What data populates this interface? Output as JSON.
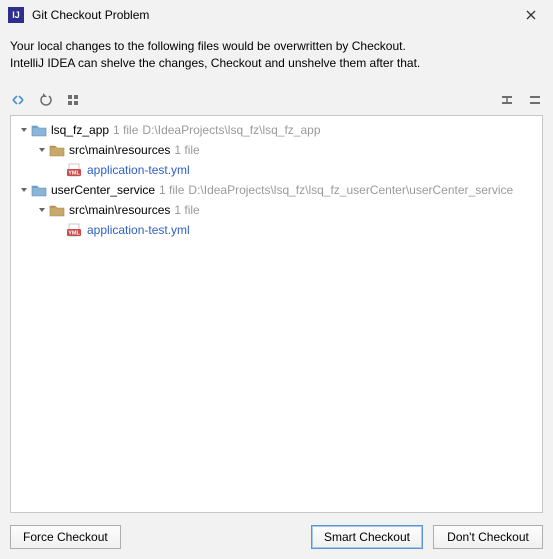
{
  "window": {
    "title": "Git Checkout Problem",
    "app_icon_text": "IJ"
  },
  "message": {
    "line1": "Your local changes to the following files would be overwritten by Checkout.",
    "line2": "IntelliJ IDEA can shelve the changes, Checkout and unshelve them after that."
  },
  "toolbar": {
    "diff": "diff-icon",
    "revert": "revert-icon",
    "group": "group-by-icon",
    "expand": "expand-all-icon",
    "collapse": "collapse-all-icon"
  },
  "tree": [
    {
      "level": 0,
      "expanded": true,
      "icon": "module",
      "label": "lsq_fz_app",
      "count": "1 file",
      "path": "D:\\IdeaProjects\\lsq_fz\\lsq_fz_app",
      "link": false
    },
    {
      "level": 1,
      "expanded": true,
      "icon": "folder",
      "label": "src\\main\\resources",
      "count": "1 file",
      "path": "",
      "link": false
    },
    {
      "level": 2,
      "expanded": null,
      "icon": "yml",
      "label": "application-test.yml",
      "count": "",
      "path": "",
      "link": true
    },
    {
      "level": 0,
      "expanded": true,
      "icon": "module",
      "label": "userCenter_service",
      "count": "1 file",
      "path": "D:\\IdeaProjects\\lsq_fz\\lsq_fz_userCenter\\userCenter_service",
      "link": false
    },
    {
      "level": 1,
      "expanded": true,
      "icon": "folder",
      "label": "src\\main\\resources",
      "count": "1 file",
      "path": "",
      "link": false
    },
    {
      "level": 2,
      "expanded": null,
      "icon": "yml",
      "label": "application-test.yml",
      "count": "",
      "path": "",
      "link": true
    }
  ],
  "buttons": {
    "force": "Force Checkout",
    "smart": "Smart Checkout",
    "dont": "Don't Checkout"
  }
}
